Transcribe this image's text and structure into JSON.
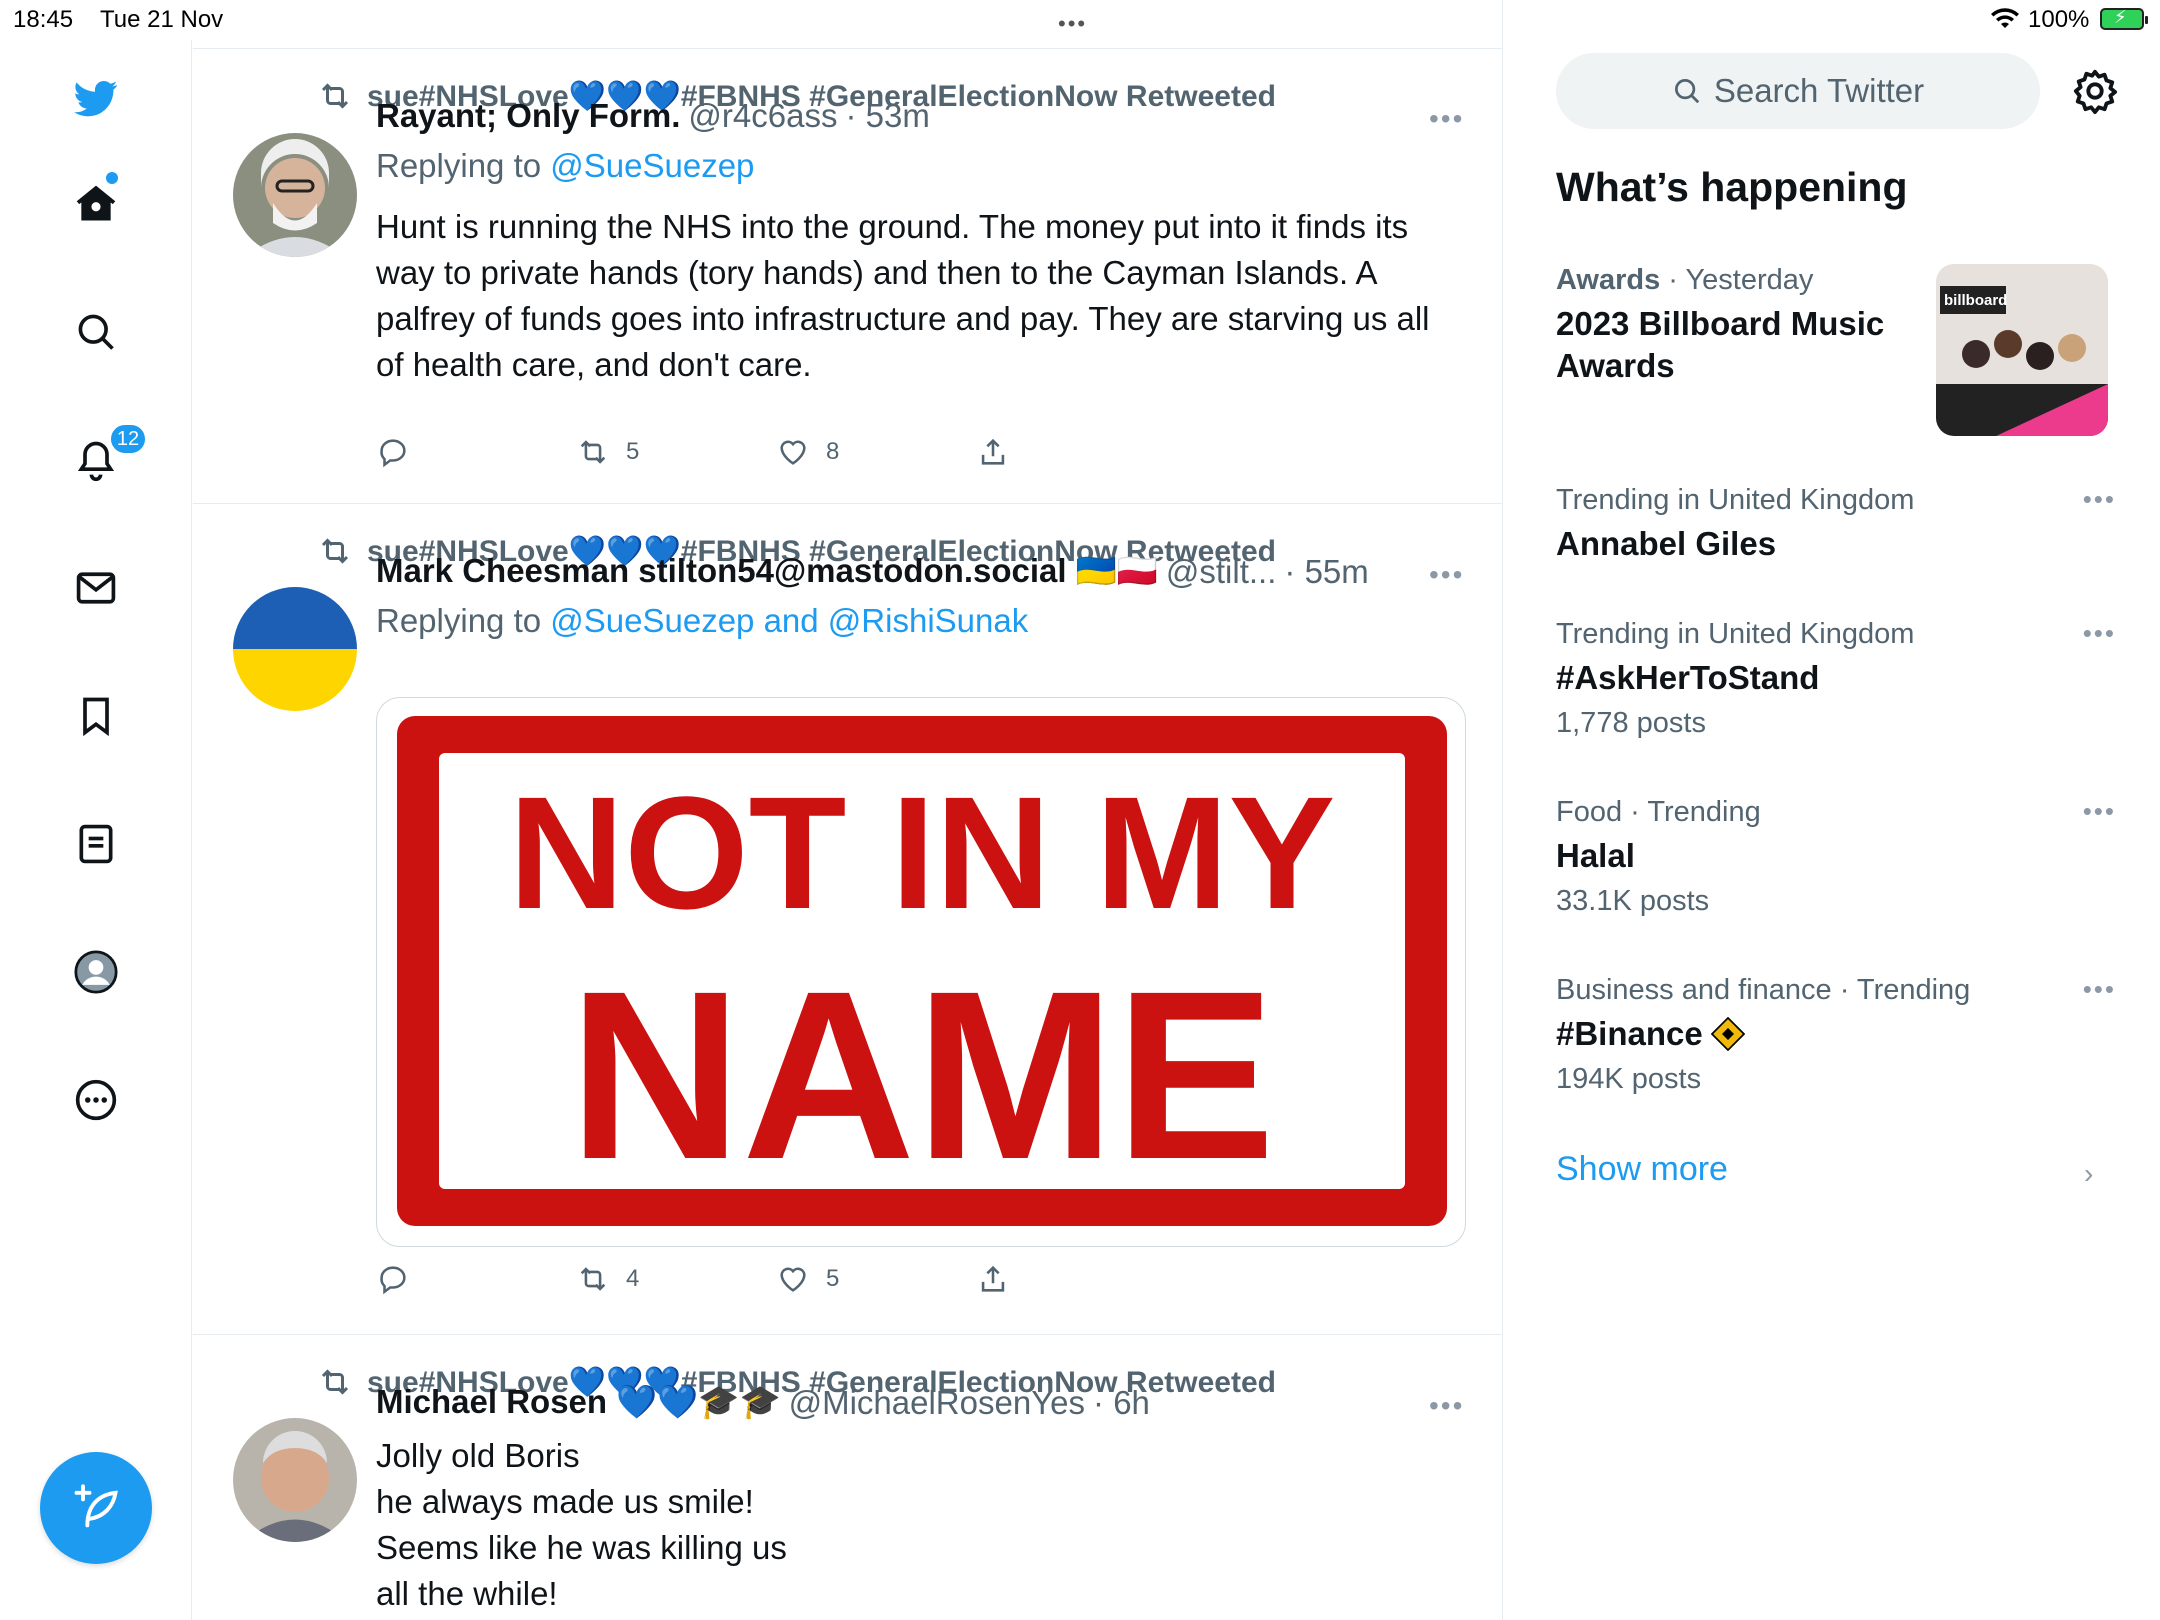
{
  "status_bar": {
    "time": "18:45",
    "date": "Tue 21 Nov",
    "battery": "100%"
  },
  "nav": {
    "notifications_badge": "12",
    "icons": [
      "twitter-logo-icon",
      "home-icon",
      "search-icon",
      "bell-icon",
      "envelope-icon",
      "bookmark-icon",
      "lists-icon",
      "profile-icon",
      "more-icon",
      "compose-icon"
    ]
  },
  "timeline": {
    "tweets": [
      {
        "retweeted_by": "sue#NHSLove💙💙💙#FBNHS #GeneralElectionNow Retweeted",
        "name": "Rayant; Only Form.",
        "handle": "@r4c6ass",
        "time": "· 53m",
        "replying_prefix": "Replying to ",
        "replying_to": "@SueSuezep",
        "text": "Hunt is running the NHS into the ground. The money put into it finds its way to private hands (tory hands) and then to the Cayman Islands. A palfrey of funds goes into infrastructure and pay. They are starving us all of health care, and don't care.",
        "retweets": "5",
        "likes": "8"
      },
      {
        "retweeted_by": "sue#NHSLove💙💙💙#FBNHS #GeneralElectionNow Retweeted",
        "name": "Mark Cheesman stilton54@mastodon.social 🇺🇦🇵🇱",
        "handle": "@stilt...",
        "time": "· 55m",
        "replying_prefix": "Replying to ",
        "replying_to": "@SueSuezep and @RishiSunak",
        "image_text_line1": "NOT IN MY",
        "image_text_line2": "NAME",
        "retweets": "4",
        "likes": "5"
      },
      {
        "retweeted_by": "sue#NHSLove💙💙💙#FBNHS #GeneralElectionNow Retweeted",
        "name": "Michael Rosen 💙💙🎓🎓",
        "handle": "@MichaelRosenYes",
        "time": "· 6h",
        "lines": [
          "Jolly old Boris",
          "he always made us smile!",
          "Seems like he was killing us",
          "all the while!"
        ]
      }
    ]
  },
  "sidebar": {
    "search_placeholder": "Search Twitter",
    "heading": "What’s happening",
    "featured": {
      "category": "Awards",
      "meta": " · Yesterday",
      "title": "2023 Billboard Music Awards",
      "thumb_label": "billboard"
    },
    "trends": [
      {
        "meta": "Trending in United Kingdom",
        "title": "Annabel Giles",
        "count": ""
      },
      {
        "meta": "Trending in United Kingdom",
        "title": "#AskHerToStand",
        "count": "1,778 posts"
      },
      {
        "meta": "Food · Trending",
        "title": "Halal",
        "count": "33.1K posts"
      },
      {
        "meta": "Business and finance · Trending",
        "title": "#Binance",
        "count": "194K posts"
      }
    ],
    "show_more": "Show more"
  },
  "colors": {
    "accent": "#1d9bf0",
    "text": "#0f1419",
    "muted": "#536471",
    "stamp_red": "#cc1111"
  }
}
